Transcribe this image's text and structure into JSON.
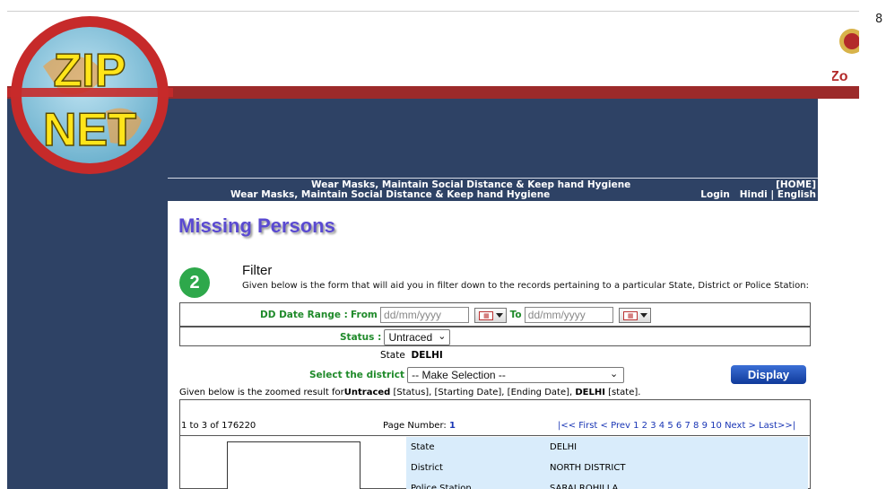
{
  "page_marker": "8",
  "logo": {
    "line1": "ZIP",
    "line2": "NET",
    "partial_right_text": "Zo"
  },
  "ticker": {
    "message_1": "Wear Masks, Maintain Social Distance & Keep hand Hygiene",
    "message_2": "Wear Masks, Maintain Social Distance & Keep hand Hygiene",
    "home_link": "[HOME]",
    "login_link": "Login",
    "hindi_link": "Hindi",
    "separator": "|",
    "english_link": "English"
  },
  "page_title": "Missing Persons",
  "filter": {
    "step_number": "2",
    "title": "Filter",
    "description": "Given below is the form that will aid you in filter down to the records pertaining to a particular State, District or Police Station:",
    "date_range_label": "DD Date Range :",
    "from_label": "From",
    "from_placeholder": "dd/mm/yyyy",
    "to_label": "To",
    "to_placeholder": "dd/mm/yyyy",
    "status_label": "Status :",
    "status_value": "Untraced",
    "state_label": "State",
    "state_value": "DELHI",
    "district_label": "Select the district",
    "district_value": "-- Make Selection --",
    "display_button": "Display"
  },
  "zoom_summary": {
    "prefix": "Given below is the zoomed result for",
    "status": "Untraced",
    "mid": " [Status], [Starting Date], [Ending Date], ",
    "state": "DELHI",
    "suffix": " [state]."
  },
  "results": {
    "range_text": "1 to 3 of 176220",
    "page_number_label": "Page Number:",
    "page_number": "1",
    "pager_open": "|<< First < Prev",
    "pages": [
      "1",
      "2",
      "3",
      "4",
      "5",
      "6",
      "7",
      "8",
      "9",
      "10"
    ],
    "pager_close": "Next > Last>>|",
    "record_rows": [
      {
        "label": "State",
        "value": "DELHI"
      },
      {
        "label": "District",
        "value": "NORTH DISTRICT"
      },
      {
        "label": "Police Station",
        "value": "SARAI ROHILLA"
      }
    ]
  }
}
